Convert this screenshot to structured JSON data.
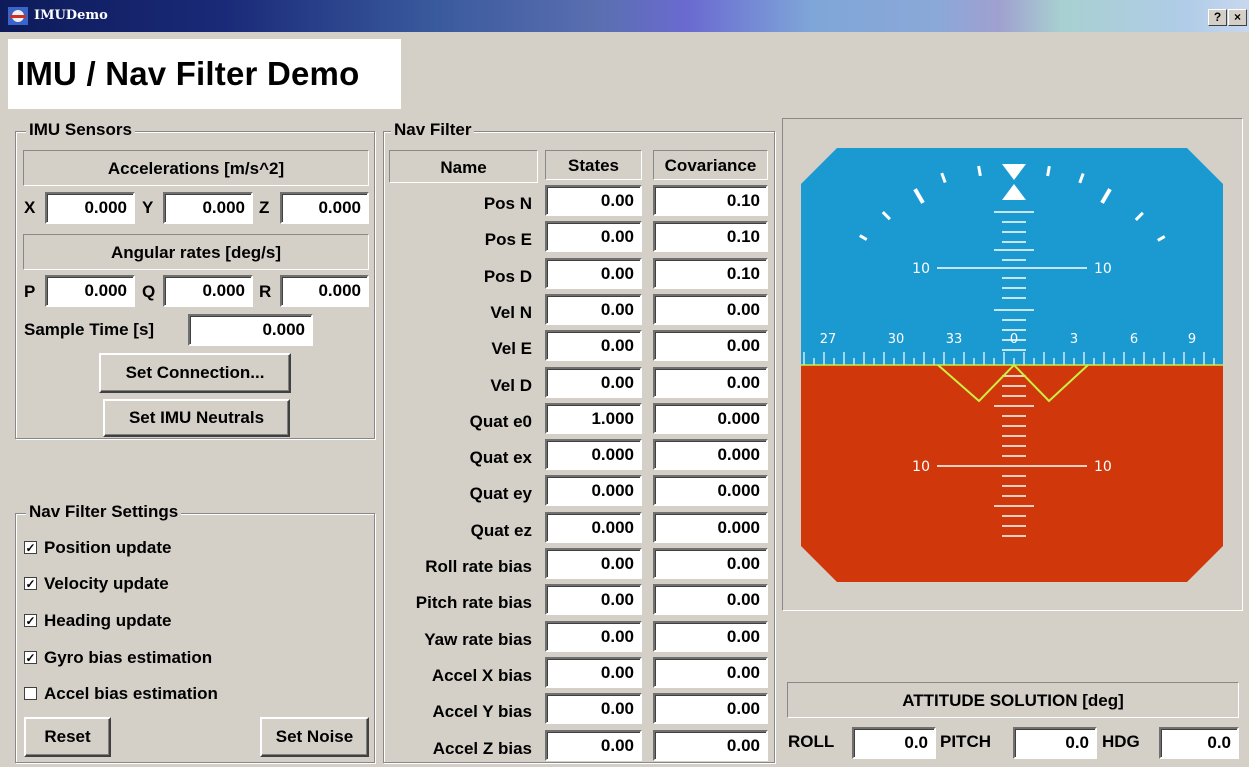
{
  "window": {
    "title": "IMUDemo",
    "help_btn": "?",
    "close_btn": "×"
  },
  "app_title": "IMU / Nav Filter Demo",
  "imu": {
    "group_label": "IMU Sensors",
    "accel_header": "Accelerations [m/s^2]",
    "rates_header": "Angular rates [deg/s]",
    "x_label": "X",
    "y_label": "Y",
    "z_label": "Z",
    "ax": "0.000",
    "ay": "0.000",
    "az": "0.000",
    "p_label": "P",
    "q_label": "Q",
    "r_label": "R",
    "p": "0.000",
    "q": "0.000",
    "r": "0.000",
    "sample_time_label": "Sample Time [s]",
    "sample_time": "0.000",
    "set_connection": "Set Connection...",
    "set_neutrals": "Set IMU Neutrals"
  },
  "settings": {
    "group_label": "Nav Filter Settings",
    "options": [
      {
        "label": "Position update",
        "checked": true
      },
      {
        "label": "Velocity update",
        "checked": true
      },
      {
        "label": "Heading update",
        "checked": true
      },
      {
        "label": "Gyro bias estimation",
        "checked": true
      },
      {
        "label": "Accel bias estimation",
        "checked": false
      }
    ],
    "check_mark": "✓",
    "reset": "Reset",
    "set_noise": "Set Noise"
  },
  "nav": {
    "group_label": "Nav Filter",
    "col_name": "Name",
    "col_states": "States",
    "col_cov": "Covariance",
    "rows": [
      {
        "name": "Pos N",
        "state": "0.00",
        "cov": "0.10"
      },
      {
        "name": "Pos E",
        "state": "0.00",
        "cov": "0.10"
      },
      {
        "name": "Pos D",
        "state": "0.00",
        "cov": "0.10"
      },
      {
        "name": "Vel N",
        "state": "0.00",
        "cov": "0.00"
      },
      {
        "name": "Vel E",
        "state": "0.00",
        "cov": "0.00"
      },
      {
        "name": "Vel D",
        "state": "0.00",
        "cov": "0.00"
      },
      {
        "name": "Quat e0",
        "state": "1.000",
        "cov": "0.000"
      },
      {
        "name": "Quat ex",
        "state": "0.000",
        "cov": "0.000"
      },
      {
        "name": "Quat ey",
        "state": "0.000",
        "cov": "0.000"
      },
      {
        "name": "Quat ez",
        "state": "0.000",
        "cov": "0.000"
      },
      {
        "name": "Roll rate bias",
        "state": "0.00",
        "cov": "0.00"
      },
      {
        "name": "Pitch rate bias",
        "state": "0.00",
        "cov": "0.00"
      },
      {
        "name": "Yaw rate bias",
        "state": "0.00",
        "cov": "0.00"
      },
      {
        "name": "Accel X bias",
        "state": "0.00",
        "cov": "0.00"
      },
      {
        "name": "Accel Y bias",
        "state": "0.00",
        "cov": "0.00"
      },
      {
        "name": "Accel Z bias",
        "state": "0.00",
        "cov": "0.00"
      }
    ]
  },
  "attitude": {
    "header": "ATTITUDE SOLUTION [deg]",
    "roll_label": "ROLL",
    "roll": "0.0",
    "pitch_label": "PITCH",
    "pitch": "0.0",
    "hdg_label": "HDG",
    "hdg": "0.0"
  },
  "adi": {
    "sky_color": "#1a9ad0",
    "ground_color": "#d0380c",
    "marker_color": "#c8f040",
    "pitch_labels": {
      "up10_left": "10",
      "up10_right": "10",
      "down10_left": "10",
      "down10_right": "10"
    },
    "heading_labels": [
      "27",
      "30",
      "33",
      "0",
      "3",
      "6",
      "9"
    ]
  }
}
